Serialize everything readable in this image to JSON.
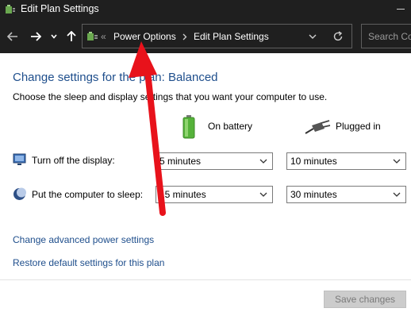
{
  "window": {
    "title": "Edit Plan Settings"
  },
  "addressbar": {
    "sep": "«",
    "crumbs": [
      "Power Options",
      "Edit Plan Settings"
    ],
    "search_placeholder": "Search Co"
  },
  "main": {
    "heading": "Change settings for the plan: Balanced",
    "description": "Choose the sleep and display settings that you want your computer to use.",
    "columns": {
      "battery": "On battery",
      "plugged": "Plugged in"
    },
    "rows": [
      {
        "label": "Turn off the display:",
        "battery_value": "5 minutes",
        "plugged_value": "10 minutes"
      },
      {
        "label": "Put the computer to sleep:",
        "battery_value": "15 minutes",
        "plugged_value": "30 minutes"
      }
    ],
    "links": [
      "Change advanced power settings",
      "Restore default settings for this plan"
    ],
    "save_button": "Save changes"
  },
  "colors": {
    "link": "#1e4e8c",
    "annotation_arrow": "#e8121b",
    "titlebar": "#1f1f1f"
  }
}
